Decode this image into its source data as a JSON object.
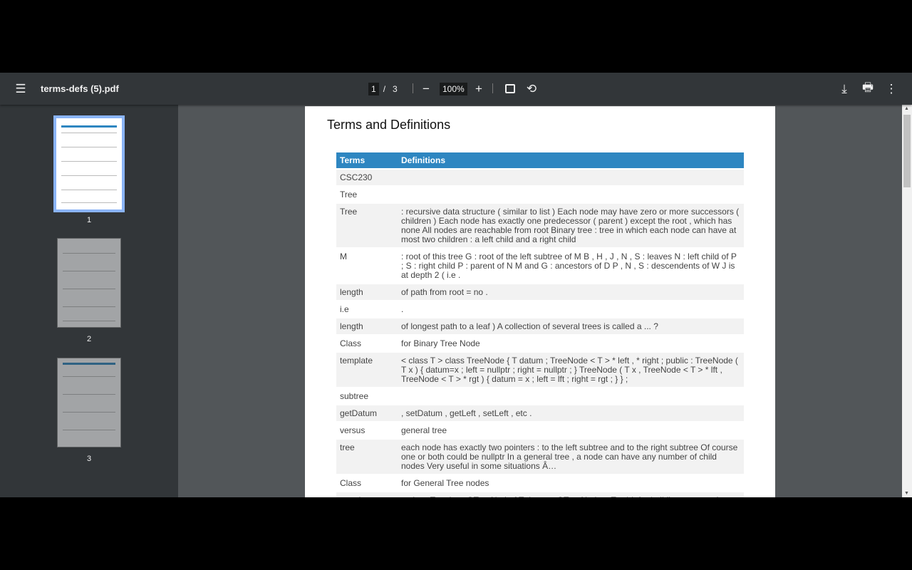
{
  "toolbar": {
    "title": "terms-defs (5).pdf",
    "page_current": "1",
    "page_sep": "/",
    "page_total": "3",
    "zoom": "100%"
  },
  "sidebar": {
    "thumbnails": [
      {
        "label": "1"
      },
      {
        "label": "2"
      },
      {
        "label": "3"
      }
    ]
  },
  "document": {
    "title": "Terms and Definitions",
    "headers": [
      "Terms",
      "Definitions"
    ],
    "rows": [
      [
        "CSC230",
        ""
      ],
      [
        "Tree",
        ""
      ],
      [
        "Tree",
        ": recursive data structure ( similar to list ) Each node may have zero or more successors ( children ) Each node has exactly one predecessor ( parent ) except the root , which has none All nodes are reachable from root Binary tree : tree in which each node can have at most two children : a left child and a right child"
      ],
      [
        "M",
        ": root of this tree G : root of the left subtree of M B , H , J , N , S : leaves N : left child of P ; S : right child P : parent of N M and G : ancestors of D P , N , S : descendents of W J is at depth 2 ( i.e ."
      ],
      [
        "length",
        "of path from root = no ."
      ],
      [
        "i.e",
        "."
      ],
      [
        "length",
        "of longest path to a leaf ) A collection of several trees is called a ... ?"
      ],
      [
        "Class",
        "for Binary Tree Node"
      ],
      [
        "template",
        "< class T > class TreeNode { T datum ; TreeNode < T > * left , * right ; public : TreeNode ( T x ) { datum=x ; left = nullptr ; right = nullptr ; } TreeNode ( T x , TreeNode < T > * lft , TreeNode < T > * rgt ) { datum = x ; left = lft ; right = rgt ; } } ;"
      ],
      [
        "subtree",
        ""
      ],
      [
        "getDatum",
        ", setDatum , getLeft , setLeft , etc ."
      ],
      [
        "versus",
        "general tree"
      ],
      [
        "tree",
        "each node has exactly two pointers : to the left subtree and to the right subtree Of course one or both could be nullptr In a general tree , a node can have any number of child nodes Very useful in some situations Â…"
      ],
      [
        "Class",
        "for General Tree nodes"
      ],
      [
        "template",
        "< class T > class GTreeNode { T datum ; GTreeNode < T > * left , * sibling ; appropriate"
      ]
    ]
  },
  "colors": {
    "header": "#2e86c1",
    "toolbar": "#323639",
    "viewer_bg": "#525659"
  }
}
